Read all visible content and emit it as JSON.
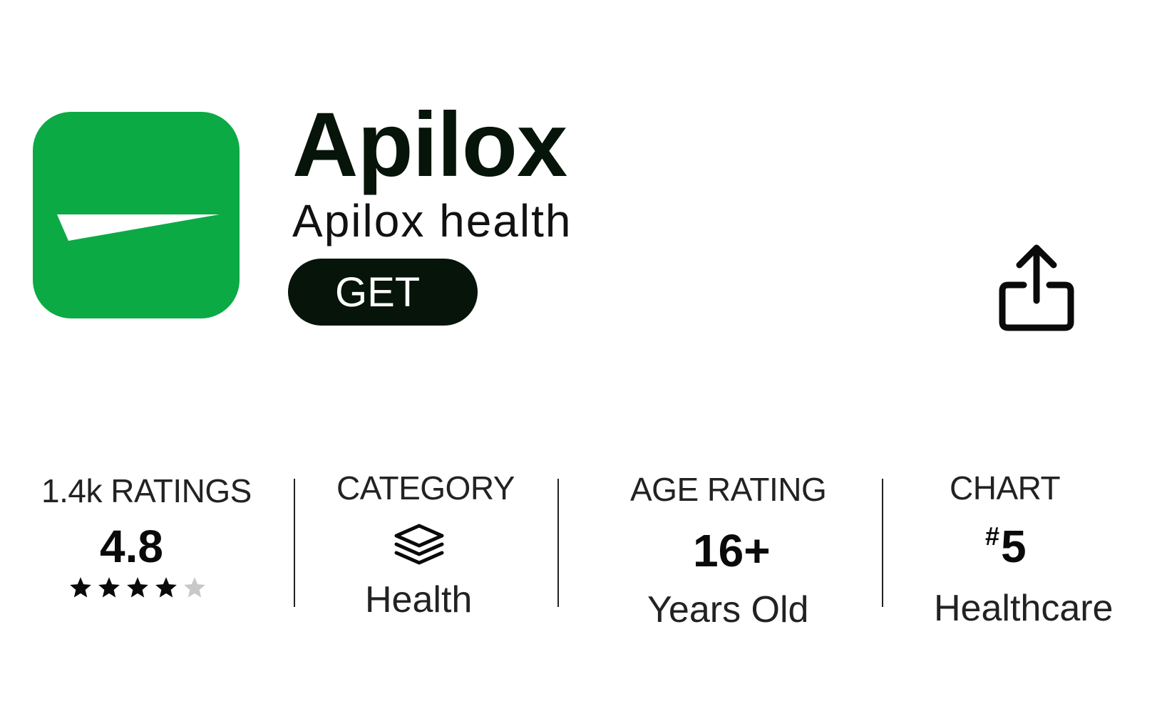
{
  "app": {
    "name": "Apilox",
    "subtitle": "Apilox health",
    "get_label": "GET",
    "icon_color": "#0BAA45"
  },
  "icons": {
    "share": "share-icon",
    "category": "layers-icon",
    "star": "star-icon"
  },
  "stats": {
    "ratings": {
      "label": "1.4k RATINGS",
      "value": "4.8",
      "stars_filled": 4,
      "stars_total": 5
    },
    "category": {
      "label": "CATEGORY",
      "value": "Health"
    },
    "age": {
      "label": "AGE RATING",
      "value": "16+",
      "sub": "Years Old"
    },
    "chart": {
      "label": "CHART",
      "hash": "#",
      "value": "5",
      "sub": "Healthcare"
    }
  },
  "colors": {
    "text_dark": "#061409",
    "star_filled": "#0a0a0a",
    "star_empty": "#c8c8c8"
  }
}
